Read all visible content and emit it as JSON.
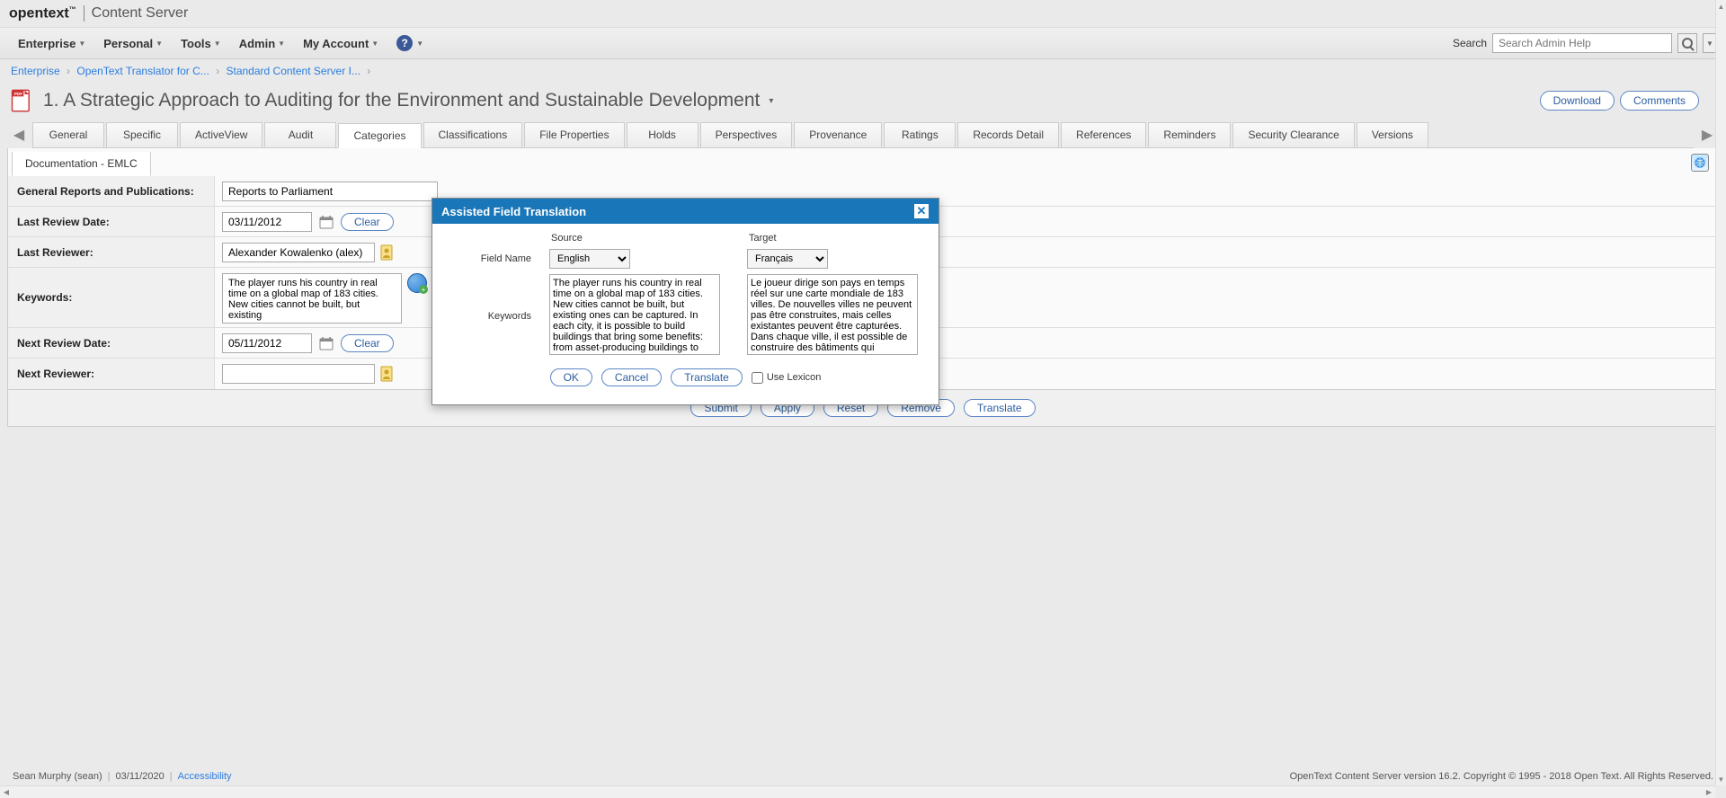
{
  "brand": {
    "name": "opentext",
    "tm": "™",
    "product": "Content Server"
  },
  "menus": {
    "enterprise": "Enterprise",
    "personal": "Personal",
    "tools": "Tools",
    "admin": "Admin",
    "my_account": "My Account"
  },
  "search": {
    "label": "Search",
    "placeholder": "Search Admin Help"
  },
  "breadcrumb": {
    "items": [
      "Enterprise",
      "OpenText Translator for C...",
      "Standard Content Server I..."
    ]
  },
  "page_title": "1. A Strategic Approach to Auditing for the Environment and Sustainable Development",
  "title_actions": {
    "download": "Download",
    "comments": "Comments"
  },
  "tabs": [
    "General",
    "Specific",
    "ActiveView",
    "Audit",
    "Categories",
    "Classifications",
    "File Properties",
    "Holds",
    "Perspectives",
    "Provenance",
    "Ratings",
    "Records Detail",
    "References",
    "Reminders",
    "Security Clearance",
    "Versions"
  ],
  "active_tab_index": 4,
  "sub_tab": "Documentation - EMLC",
  "fields": {
    "general_reports_label": "General Reports and Publications:",
    "general_reports_value": "Reports to Parliament",
    "last_review_date_label": "Last Review Date:",
    "last_review_date_value": "03/11/2012",
    "clear": "Clear",
    "last_reviewer_label": "Last Reviewer:",
    "last_reviewer_value": "Alexander Kowalenko (alex)",
    "keywords_label": "Keywords:",
    "keywords_value": "The player runs his country in real time on a global map of 183 cities. New cities cannot be built, but existing",
    "next_review_date_label": "Next Review Date:",
    "next_review_date_value": "05/11/2012",
    "next_reviewer_label": "Next Reviewer:",
    "next_reviewer_value": ""
  },
  "bottom_buttons": {
    "submit": "Submit",
    "apply": "Apply",
    "reset": "Reset",
    "remove": "Remove",
    "translate": "Translate"
  },
  "modal": {
    "title": "Assisted Field Translation",
    "source_label": "Source",
    "target_label": "Target",
    "field_name_label": "Field Name",
    "keywords_label": "Keywords",
    "source_lang": "English",
    "target_lang": "Français",
    "source_text": "The player runs his country in real time on a global map of 183 cities. New cities cannot be built, but existing ones can be captured. In each city, it is possible to build buildings that bring some benefits: from asset-producing buildings to troop-manufacturing buildings",
    "target_text": "Le joueur dirige son pays en temps réel sur une carte mondiale de 183 villes. De nouvelles villes ne peuvent pas être construites, mais celles existantes peuvent être capturées. Dans chaque ville, il est possible de construire des bâtiments qui",
    "ok": "OK",
    "cancel": "Cancel",
    "translate": "Translate",
    "use_lexicon": "Use Lexicon"
  },
  "footer": {
    "user": "Sean Murphy (sean)",
    "date": "03/11/2020",
    "accessibility": "Accessibility",
    "copyright": "OpenText Content Server version 16.2. Copyright © 1995 - 2018 Open Text. All Rights Reserved."
  }
}
